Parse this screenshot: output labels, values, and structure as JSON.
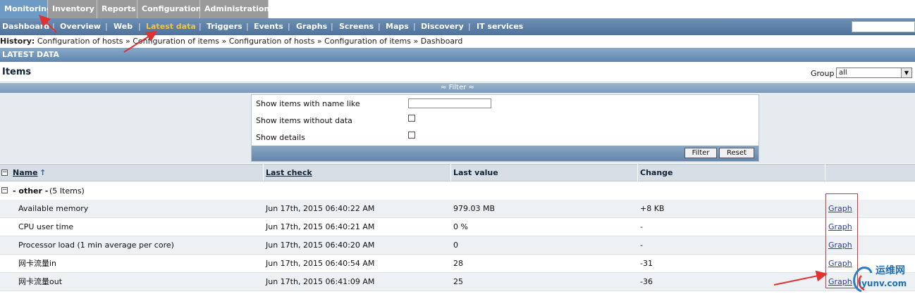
{
  "top_menu": [
    "Monitoring",
    "Inventory",
    "Reports",
    "Configuration",
    "Administration"
  ],
  "sub_menu": [
    "Dashboard",
    "Overview",
    "Web",
    "Latest data",
    "Triggers",
    "Events",
    "Graphs",
    "Screens",
    "Maps",
    "Discovery",
    "IT services"
  ],
  "history": {
    "label": "History:",
    "items": [
      "Configuration of hosts",
      "Configuration of items",
      "Configuration of hosts",
      "Configuration of items",
      "Dashboard"
    ]
  },
  "section_title": "LATEST DATA",
  "items_title": "Items",
  "group": {
    "label": "Group",
    "value": "all"
  },
  "filter": {
    "bar_label": "≈ Filter ≈",
    "name_like_label": "Show items with name like",
    "without_data_label": "Show items without data",
    "details_label": "Show details",
    "filter_button": "Filter",
    "reset_button": "Reset"
  },
  "table": {
    "headers": {
      "name": "Name",
      "last_check": "Last check",
      "last_value": "Last value",
      "change": "Change"
    },
    "group_label": "- other -",
    "group_count": "(5 Items)",
    "rows": [
      {
        "name": "Available memory",
        "last_check": "Jun 17th, 2015 06:40:22 AM",
        "last_value": "979.03 MB",
        "change": "+8 KB",
        "link": "Graph"
      },
      {
        "name": "CPU user time",
        "last_check": "Jun 17th, 2015 06:40:21 AM",
        "last_value": "0 %",
        "change": "-",
        "link": "Graph"
      },
      {
        "name": "Processor load (1 min average per core)",
        "last_check": "Jun 17th, 2015 06:40:20 AM",
        "last_value": "0",
        "change": "-",
        "link": "Graph"
      },
      {
        "name": "网卡流量in",
        "last_check": "Jun 17th, 2015 06:40:54 AM",
        "last_value": "28",
        "change": "-31",
        "link": "Graph"
      },
      {
        "name": "网卡流量out",
        "last_check": "Jun 17th, 2015 06:41:09 AM",
        "last_value": "25",
        "change": "-36",
        "link": "Graph"
      }
    ]
  },
  "watermark": {
    "line1": "运维网",
    "line2": "iyunv.com"
  },
  "colors": {
    "accent": "#4f739d",
    "active_submenu": "#f7c23b",
    "annotation": "#d33"
  }
}
